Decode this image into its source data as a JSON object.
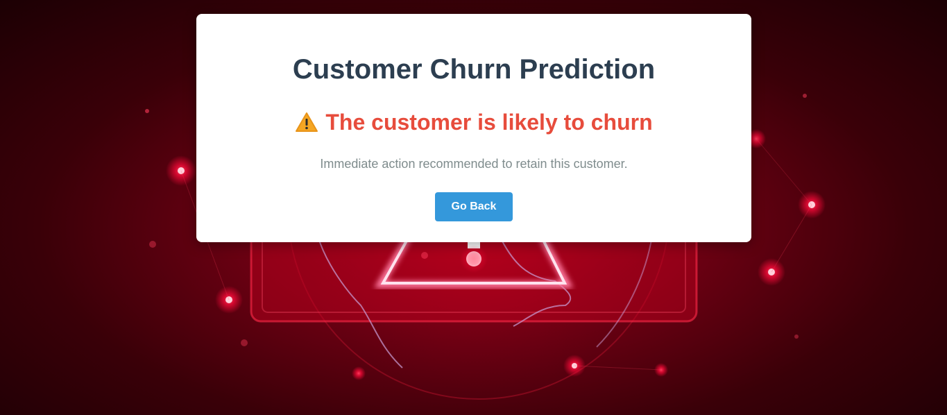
{
  "card": {
    "title": "Customer Churn Prediction",
    "result_text": "The customer is likely to churn",
    "result_icon": "warning-icon",
    "subtext": "Immediate action recommended to retain this customer.",
    "back_button_label": "Go Back"
  },
  "colors": {
    "title": "#2c3e50",
    "result": "#e74c3c",
    "subtext": "#7f8c8d",
    "button": "#3498db",
    "background": "#6a0012"
  }
}
